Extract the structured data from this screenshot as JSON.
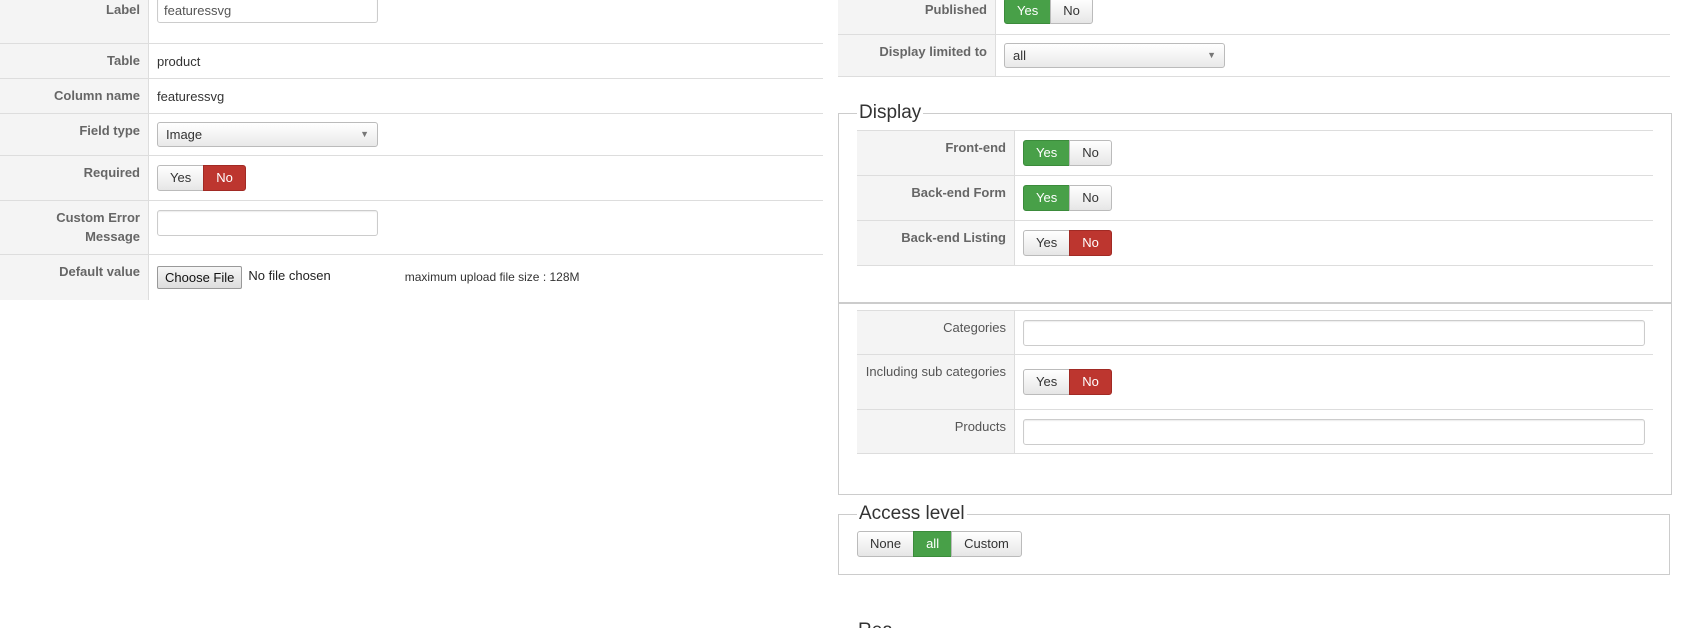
{
  "left": {
    "label_label": "Label",
    "label_value": "featuressvg",
    "table_label": "Table",
    "table_value": "product",
    "column_label": "Column name",
    "column_value": "featuressvg",
    "fieldtype_label": "Field type",
    "fieldtype_value": "Image",
    "required_label": "Required",
    "required_yes": "Yes",
    "required_no": "No",
    "error_label": "Custom Error Message",
    "error_value": "",
    "default_label": "Default value",
    "file_button": "Choose File",
    "file_status": "No file chosen",
    "upload_note": "maximum upload file size : 128M"
  },
  "right": {
    "published_label": "Published",
    "published_yes": "Yes",
    "published_no": "No",
    "limited_label": "Display limited to",
    "limited_value": "all",
    "display_legend": "Display",
    "frontend_label": "Front-end",
    "frontend_yes": "Yes",
    "frontend_no": "No",
    "backform_label": "Back-end Form",
    "backform_yes": "Yes",
    "backform_no": "No",
    "backlist_label": "Back-end Listing",
    "backlist_yes": "Yes",
    "backlist_no": "No",
    "categories_label": "Categories",
    "subcat_label": "Including sub categories",
    "subcat_yes": "Yes",
    "subcat_no": "No",
    "products_label": "Products",
    "access_legend": "Access level",
    "access_none": "None",
    "access_all": "all",
    "access_custom": "Custom",
    "partial_legend": "Rea"
  },
  "colors": {
    "active_yes": "#48a048",
    "active_no": "#bd362f"
  }
}
